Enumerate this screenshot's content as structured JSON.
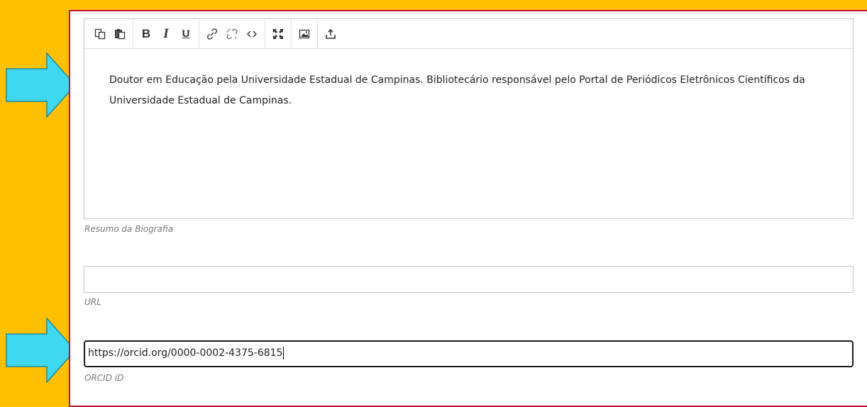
{
  "colors": {
    "background": "#FFC000",
    "panel_border": "#C8102E",
    "arrow_fill": "#40D8F0",
    "arrow_stroke": "#1F8A96"
  },
  "toolbar": {
    "items": [
      {
        "name": "copy-icon"
      },
      {
        "name": "paste-icon"
      },
      {
        "name": "bold-button",
        "label": "B"
      },
      {
        "name": "italic-button",
        "label": "I"
      },
      {
        "name": "underline-button",
        "label": "U"
      },
      {
        "name": "link-icon"
      },
      {
        "name": "unlink-icon"
      },
      {
        "name": "code-icon"
      },
      {
        "name": "fullscreen-icon"
      },
      {
        "name": "image-icon"
      },
      {
        "name": "upload-icon"
      }
    ]
  },
  "bio": {
    "text": "Doutor em Educação pela Universidade Estadual de Campinas. Bibliotecário responsável pelo Portal de Periódicos Eletrônicos Científicos da Universidade Estadual de Campinas.",
    "label": "Resumo da Biografia"
  },
  "url": {
    "value": "",
    "label": "URL"
  },
  "orcid": {
    "value": "https://orcid.org/0000-0002-4375-6815",
    "label": "ORCID iD"
  }
}
